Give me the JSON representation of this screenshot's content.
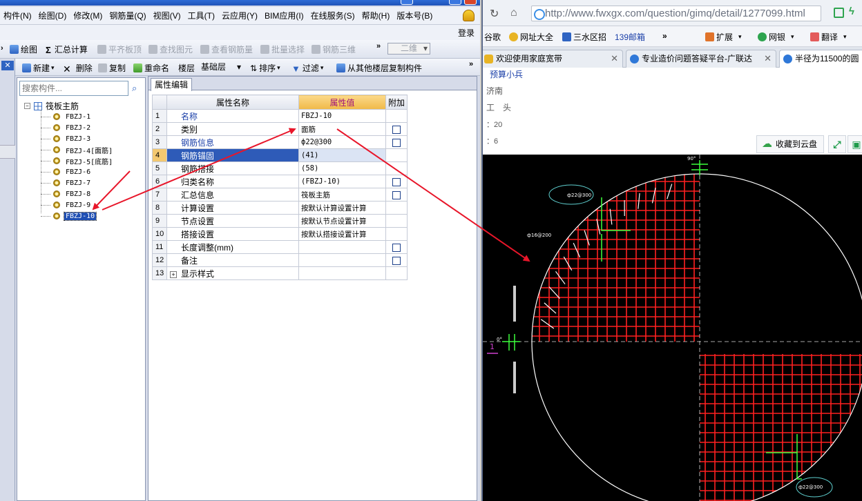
{
  "app": {
    "menu": [
      "构件(N)",
      "绘图(D)",
      "修改(M)",
      "钢筋量(Q)",
      "视图(V)",
      "工具(T)",
      "云应用(Y)",
      "BIM应用(I)",
      "在线服务(S)",
      "帮助(H)",
      "版本号(B)"
    ],
    "login": "登录",
    "toolbar1": {
      "draw": "绘图",
      "summary": "汇总计算",
      "level_slab": "平齐板顶",
      "find": "查找图元",
      "view_rebar": "查看钢筋量",
      "batch": "批量选择",
      "rebar3d": "钢筋三维",
      "view_mode": "二维",
      "more": "»"
    },
    "toolbar2": {
      "new": "新建",
      "delete": "删除",
      "copy": "复制",
      "rename": "重命名",
      "floor_label": "楼层",
      "floor_value": "基础层",
      "sort": "排序",
      "filter": "过滤",
      "copy_from": "从其他楼层复制构件",
      "more": "»"
    },
    "search_placeholder": "搜索构件...",
    "tree": {
      "root": "筏板主筋",
      "items": [
        "FBZJ-1",
        "FBZJ-2",
        "FBZJ-3",
        "FBZJ-4[面筋]",
        "FBZJ-5[底筋]",
        "FBZJ-6",
        "FBZJ-7",
        "FBZJ-8",
        "FBZJ-9",
        "FBZJ-10"
      ],
      "selected_index": 9
    },
    "prop_tab": "属性编辑",
    "props": {
      "headers": {
        "name": "属性名称",
        "value": "属性值",
        "extra": "附加"
      },
      "rows": [
        {
          "num": "1",
          "name": "名称",
          "value": "FBZJ-10",
          "check": false,
          "blue": true
        },
        {
          "num": "2",
          "name": "类别",
          "value": "面筋",
          "check": true,
          "blue": false
        },
        {
          "num": "3",
          "name": "钢筋信息",
          "value": "ф22@300",
          "check": true,
          "blue": true
        },
        {
          "num": "4",
          "name": "钢筋锚固",
          "value": "(41)",
          "check": false,
          "blue": true
        },
        {
          "num": "5",
          "name": "钢筋搭接",
          "value": "(58)",
          "check": false,
          "blue": false
        },
        {
          "num": "6",
          "name": "归类名称",
          "value": "(FBZJ-10)",
          "check": true,
          "blue": false
        },
        {
          "num": "7",
          "name": "汇总信息",
          "value": "筏板主筋",
          "check": true,
          "blue": false
        },
        {
          "num": "8",
          "name": "计算设置",
          "value": "按默认计算设置计算",
          "check": false,
          "blue": false
        },
        {
          "num": "9",
          "name": "节点设置",
          "value": "按默认节点设置计算",
          "check": false,
          "blue": false
        },
        {
          "num": "10",
          "name": "搭接设置",
          "value": "按默认搭接设置计算",
          "check": false,
          "blue": false
        },
        {
          "num": "11",
          "name": "长度调整(mm)",
          "value": "",
          "check": true,
          "blue": false
        },
        {
          "num": "12",
          "name": "备注",
          "value": "",
          "check": true,
          "blue": false
        },
        {
          "num": "13",
          "name": "显示样式",
          "value": "",
          "check": false,
          "blue": false
        }
      ],
      "selected_row": 3
    }
  },
  "browser": {
    "url": "http://www.fwxgx.com/question/gimq/detail/1277099.html",
    "bookmarks": [
      "谷歌",
      "网址大全",
      "三水区招",
      "139邮箱",
      "»",
      "扩展",
      "网银",
      "翻译"
    ],
    "tabs": [
      "欢迎使用家庭宽带",
      "专业造价问题答疑平台-广联达",
      "半径为11500的圆"
    ],
    "page": {
      "user": "预算小兵",
      "city": "济南",
      "job": "工　头",
      "stat1": "：20",
      "stat2": "：6",
      "save_cloud": "收藏到云盘"
    },
    "cad": {
      "angle_top": "90°",
      "angle_left": "0°",
      "label_rebar_a": "ф22@300",
      "label_rebar_b": "ф16@200",
      "label_rebar_c": "ф22@300",
      "marker_1": "1"
    }
  },
  "colors": {
    "rebar": "#ff2020",
    "cad_bg": "#000000",
    "arrow": "#e8162a",
    "circle": "#ffffff"
  }
}
